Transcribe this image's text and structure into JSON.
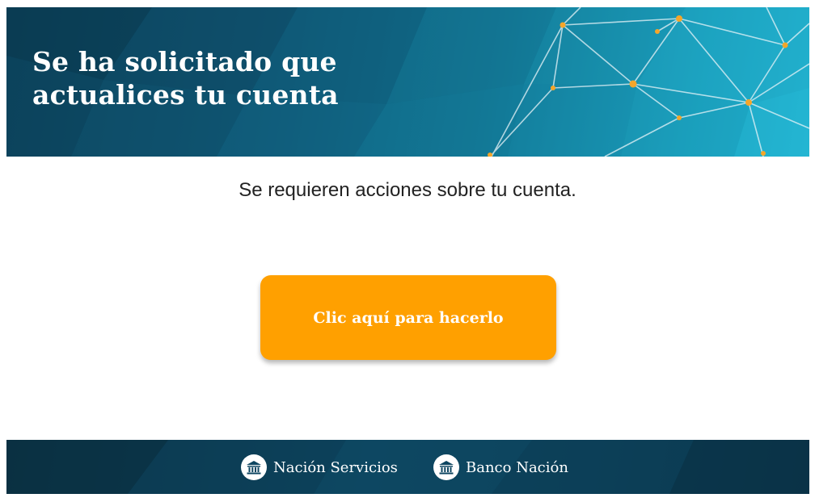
{
  "banner": {
    "title_line1": "Se ha solicitado que",
    "title_line2": "actualices tu cuenta"
  },
  "message": "Se requieren acciones sobre tu cuenta.",
  "cta": {
    "label": "Clic aquí para hacerlo",
    "color": "#ffa000"
  },
  "footer": {
    "brands": [
      {
        "label": "Nación Servicios",
        "icon": "bank-building-icon"
      },
      {
        "label": "Banco Nación",
        "icon": "bank-building-icon"
      }
    ]
  },
  "colors": {
    "banner_dark": "#0b3f57",
    "banner_light": "#22b5d2",
    "accent_nodes": "#f4a62a",
    "footer": "#0d4560"
  }
}
